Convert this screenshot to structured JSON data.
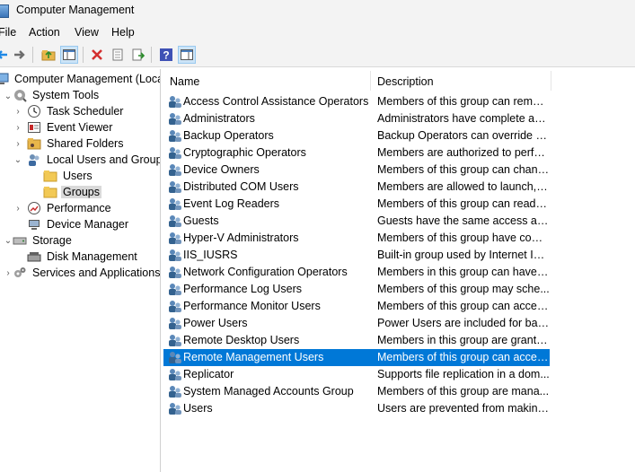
{
  "window": {
    "title": "Computer Management"
  },
  "menu": [
    "File",
    "Action",
    "View",
    "Help"
  ],
  "toolbar": {
    "icons": [
      "back-arrow-icon",
      "forward-arrow-icon",
      "up-folder-icon",
      "show-hide-tree-icon",
      "delete-icon",
      "properties-icon",
      "export-list-icon",
      "help-icon",
      "show-hide-action-pane-icon"
    ]
  },
  "tree": {
    "items": [
      {
        "label": "Computer Management (Local",
        "icon": "computer-management-icon"
      },
      {
        "label": "System Tools",
        "icon": "system-tools-icon"
      },
      {
        "label": "Task Scheduler",
        "icon": "clock-icon"
      },
      {
        "label": "Event Viewer",
        "icon": "event-viewer-icon"
      },
      {
        "label": "Shared Folders",
        "icon": "shared-folder-icon"
      },
      {
        "label": "Local Users and Groups",
        "icon": "users-icon"
      },
      {
        "label": "Users",
        "icon": "folder-icon"
      },
      {
        "label": "Groups",
        "icon": "folder-icon"
      },
      {
        "label": "Performance",
        "icon": "performance-icon"
      },
      {
        "label": "Device Manager",
        "icon": "device-manager-icon"
      },
      {
        "label": "Storage",
        "icon": "storage-icon"
      },
      {
        "label": "Disk Management",
        "icon": "disk-icon"
      },
      {
        "label": "Services and Applications",
        "icon": "services-icon"
      }
    ]
  },
  "list": {
    "columns": [
      "Name",
      "Description"
    ],
    "rows": [
      {
        "name": "Access Control Assistance Operators",
        "desc": "Members of this group can remot..."
      },
      {
        "name": "Administrators",
        "desc": "Administrators have complete an..."
      },
      {
        "name": "Backup Operators",
        "desc": "Backup Operators can override se..."
      },
      {
        "name": "Cryptographic Operators",
        "desc": "Members are authorized to perfor..."
      },
      {
        "name": "Device Owners",
        "desc": "Members of this group can chang..."
      },
      {
        "name": "Distributed COM Users",
        "desc": "Members are allowed to launch, a..."
      },
      {
        "name": "Event Log Readers",
        "desc": "Members of this group can read e..."
      },
      {
        "name": "Guests",
        "desc": "Guests have the same access as m..."
      },
      {
        "name": "Hyper-V Administrators",
        "desc": "Members of this group have com..."
      },
      {
        "name": "IIS_IUSRS",
        "desc": "Built-in group used by Internet Inf..."
      },
      {
        "name": "Network Configuration Operators",
        "desc": "Members in this group can have s..."
      },
      {
        "name": "Performance Log Users",
        "desc": "Members of this group may sche..."
      },
      {
        "name": "Performance Monitor Users",
        "desc": "Members of this group can acces..."
      },
      {
        "name": "Power Users",
        "desc": "Power Users are included for back..."
      },
      {
        "name": "Remote Desktop Users",
        "desc": "Members in this group are grante..."
      },
      {
        "name": "Remote Management Users",
        "desc": "Members of this group can acces..."
      },
      {
        "name": "Replicator",
        "desc": "Supports file replication in a dom..."
      },
      {
        "name": "System Managed Accounts Group",
        "desc": "Members of this group are mana..."
      },
      {
        "name": "Users",
        "desc": "Users are prevented from making ..."
      }
    ],
    "selected_row": "Remote Management Users"
  },
  "colors": {
    "selection": "#0078d7",
    "tree_selection": "#d9d9d9",
    "chrome": "#f3f3f3"
  }
}
